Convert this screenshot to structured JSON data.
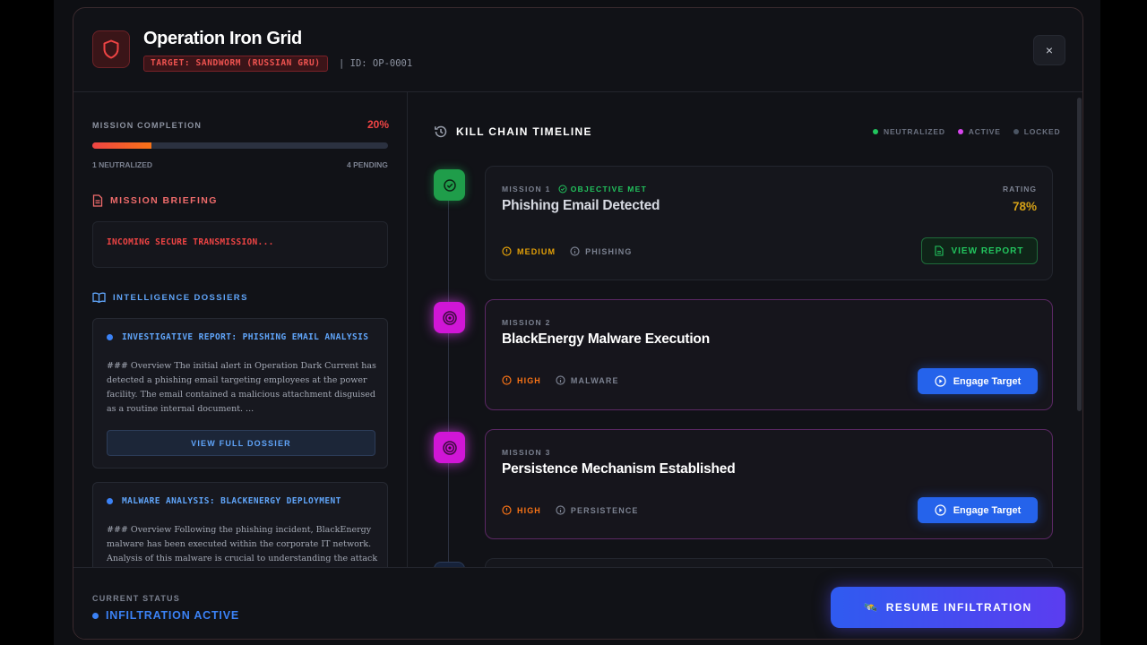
{
  "header": {
    "title": "Operation Iron Grid",
    "target": "TARGET: SANDWORM (RUSSIAN GRU)",
    "op_id": "| ID: OP-0001",
    "close": "×"
  },
  "progress": {
    "label": "MISSION COMPLETION",
    "percent_text": "20%",
    "percent": 0.2,
    "neutralized": "1 NEUTRALIZED",
    "pending": "4 PENDING"
  },
  "briefing": {
    "heading": "MISSION BRIEFING",
    "text": "INCOMING SECURE TRANSMISSION..."
  },
  "dossiers": {
    "heading": "INTELLIGENCE DOSSIERS",
    "items": [
      {
        "title": "INVESTIGATIVE REPORT: PHISHING EMAIL ANALYSIS",
        "body": "### Overview The initial alert in Operation Dark Current has detected a phishing email targeting employees at the power facility. The email contained a malicious attachment disguised as a routine internal document. ...",
        "button": "VIEW FULL DOSSIER"
      },
      {
        "title": "MALWARE ANALYSIS: BLACKENERGY DEPLOYMENT",
        "body": "### Overview Following the phishing incident, BlackEnergy malware has been executed within the corporate IT network. Analysis of this malware is crucial to understanding the attack vector and preventing further incidents"
      }
    ]
  },
  "timeline": {
    "heading": "KILL CHAIN TIMELINE",
    "legend": [
      "NEUTRALIZED",
      "ACTIVE",
      "LOCKED"
    ],
    "legend_colors": [
      "#22c55e",
      "#d946ef",
      "#4b5563"
    ],
    "missions": [
      {
        "label": "MISSION 1",
        "status": "OBJECTIVE MET",
        "title": "Phishing Email Detected",
        "rating_label": "RATING",
        "rating": "78%",
        "severity": "MEDIUM",
        "category": "PHISHING",
        "action": "VIEW REPORT"
      },
      {
        "label": "MISSION 2",
        "title": "BlackEnergy Malware Execution",
        "severity": "HIGH",
        "category": "MALWARE",
        "action": "Engage Target"
      },
      {
        "label": "MISSION 3",
        "title": "Persistence Mechanism Established",
        "severity": "HIGH",
        "category": "PERSISTENCE",
        "action": "Engage Target"
      }
    ]
  },
  "footer": {
    "status_label": "CURRENT STATUS",
    "status_value": "INFILTRATION ACTIVE",
    "resume_button": "RESUME INFILTRATION",
    "resume_icon": "🛰️"
  }
}
